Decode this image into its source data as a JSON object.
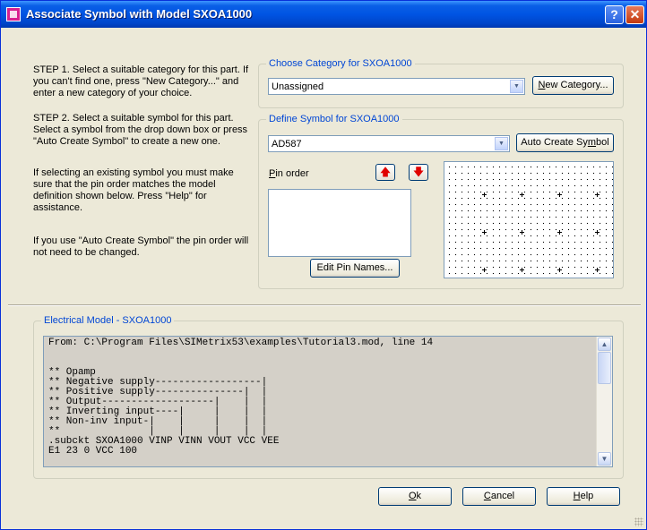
{
  "window": {
    "title": "Associate Symbol with Model SXOA1000",
    "help_glyph": "?",
    "close_glyph": "✕"
  },
  "instructions": {
    "step1": "STEP 1. Select a suitable category for this part. If you can't find one, press \"New Category...\" and enter a new category of your choice.",
    "step2": "STEP 2. Select a suitable symbol for this part. Select a symbol from the drop down box or press \"Auto Create Symbol\" to create a new one.",
    "existing_note": "If selecting an existing symbol you must make sure that the pin order matches the model definition shown below. Press \"Help\" for assistance.",
    "auto_note": "If you use \"Auto Create Symbol\" the pin order will not need to be changed."
  },
  "category": {
    "group_label": "Choose Category for SXOA1000",
    "selected": "Unassigned",
    "new_button_prefix": "",
    "new_button_mnemonic": "N",
    "new_button_rest": "ew Category..."
  },
  "symbol": {
    "group_label": "Define Symbol for SXOA1000",
    "selected": "AD587",
    "auto_button_prefix": "Auto Create Sy",
    "auto_button_mnemonic": "m",
    "auto_button_rest": "bol",
    "pin_order_mnemonic": "P",
    "pin_order_rest": "in order",
    "edit_pins_label": "Edit Pin Names...",
    "up_arrow": "🡅",
    "down_arrow": "🡇"
  },
  "model": {
    "group_label": "Electrical Model - SXOA1000",
    "text": "From: C:\\Program Files\\SIMetrix53\\examples\\Tutorial3.mod, line 14\n\n\n** Opamp\n** Negative supply------------------|\n** Positive supply---------------|  |\n** Output-------------------|    |  |\n** Inverting input----|     |    |  |\n** Non-inv input-|    |     |    |  |\n**               |    |     |    |  |\n.subckt SXOA1000 VINP VINN VOUT VCC VEE\nE1 23 0 VCC 100"
  },
  "scrollbar": {
    "up_glyph": "▲",
    "down_glyph": "▼"
  },
  "buttons": {
    "ok_mnemonic": "O",
    "ok_rest": "k",
    "cancel_mnemonic": "C",
    "cancel_rest": "ancel",
    "help_mnemonic": "H",
    "help_rest": "elp"
  },
  "combo_arrow_glyph": "▼",
  "colors": {
    "group_label": "#0046d5",
    "title_bar": "#0054e3",
    "arrow_red": "#e00000"
  }
}
